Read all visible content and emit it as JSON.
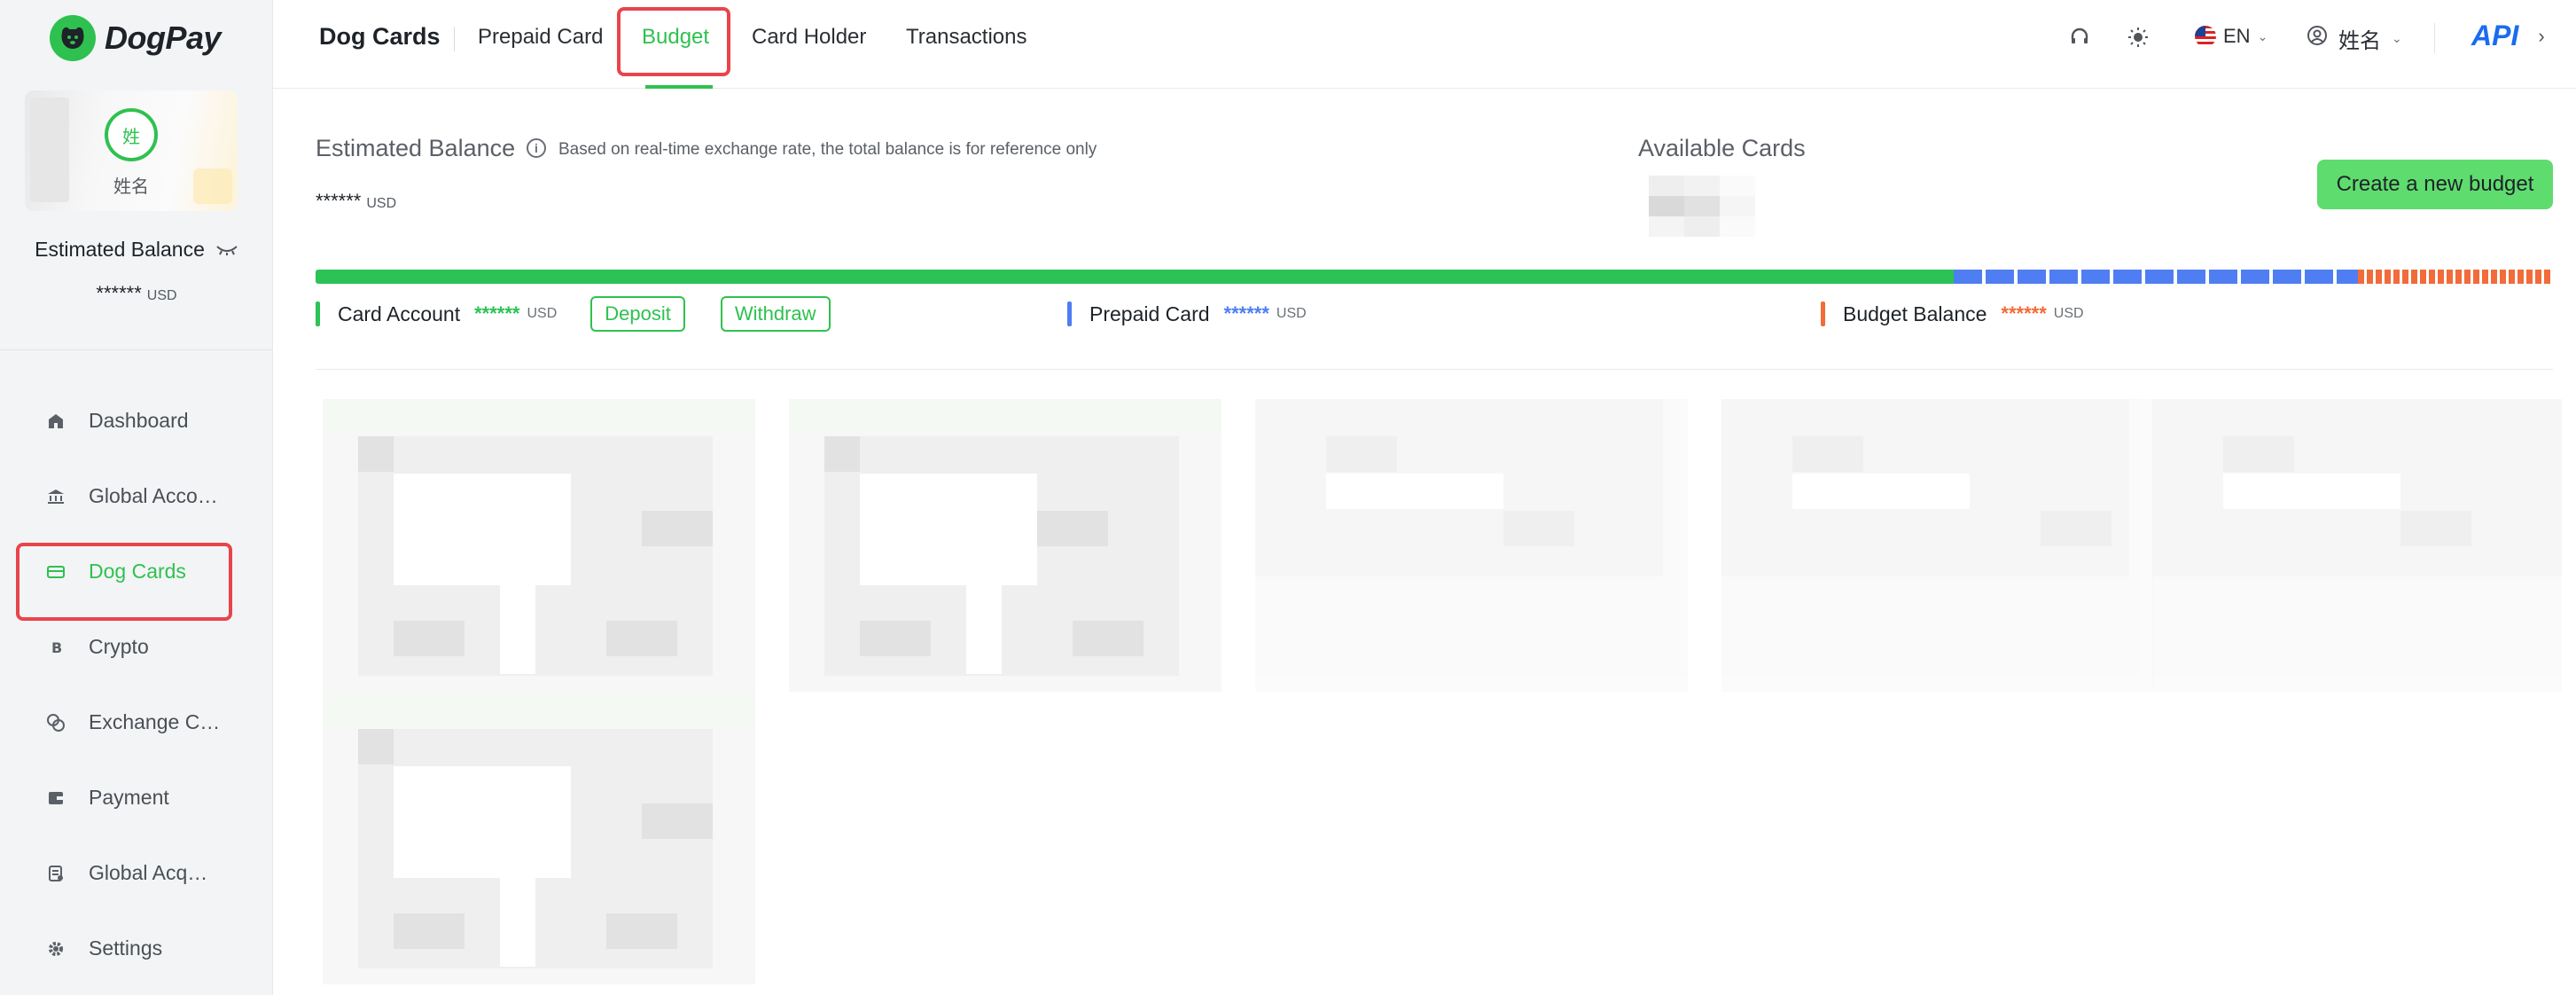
{
  "brand": {
    "name": "DogPay"
  },
  "profile": {
    "avatar_char": "姓",
    "name": "姓名"
  },
  "sidebar_balance": {
    "label": "Estimated Balance",
    "value": "******",
    "currency": "USD"
  },
  "nav": [
    {
      "label": "Dashboard",
      "icon": "home-icon"
    },
    {
      "label": "Global Acco…",
      "icon": "bank-icon"
    },
    {
      "label": "Dog Cards",
      "icon": "card-icon",
      "active": true
    },
    {
      "label": "Crypto",
      "icon": "bitcoin-icon"
    },
    {
      "label": "Exchange C…",
      "icon": "exchange-icon"
    },
    {
      "label": "Payment",
      "icon": "wallet-icon"
    },
    {
      "label": "Global Acq…",
      "icon": "document-icon"
    },
    {
      "label": "Settings",
      "icon": "gear-icon"
    }
  ],
  "header": {
    "title": "Dog Cards",
    "tabs": [
      "Prepaid Card",
      "Budget",
      "Card Holder",
      "Transactions"
    ],
    "active_tab": "Budget",
    "language": "EN",
    "user": "姓名",
    "api": "API"
  },
  "main": {
    "estimated_balance": {
      "label": "Estimated Balance",
      "note": "Based on real-time exchange rate, the total balance is for reference only",
      "value": "******",
      "currency": "USD"
    },
    "available_cards": {
      "label": "Available Cards"
    },
    "create_button": "Create a new budget",
    "balance_bar": {
      "card_account_fraction": 0.732,
      "prepaid_fraction": 0.181,
      "budget_fraction": 0.087
    },
    "legend": {
      "card_account": {
        "label": "Card Account",
        "value": "******",
        "currency": "USD"
      },
      "deposit": "Deposit",
      "withdraw": "Withdraw",
      "prepaid": {
        "label": "Prepaid Card",
        "value": "******",
        "currency": "USD"
      },
      "budget": {
        "label": "Budget Balance",
        "value": "******",
        "currency": "USD"
      }
    }
  },
  "colors": {
    "accent": "#2fc14f",
    "card_account": "#2cc256",
    "prepaid": "#4f7ef2",
    "budget": "#f26b3a",
    "highlight": "#e8454a"
  }
}
